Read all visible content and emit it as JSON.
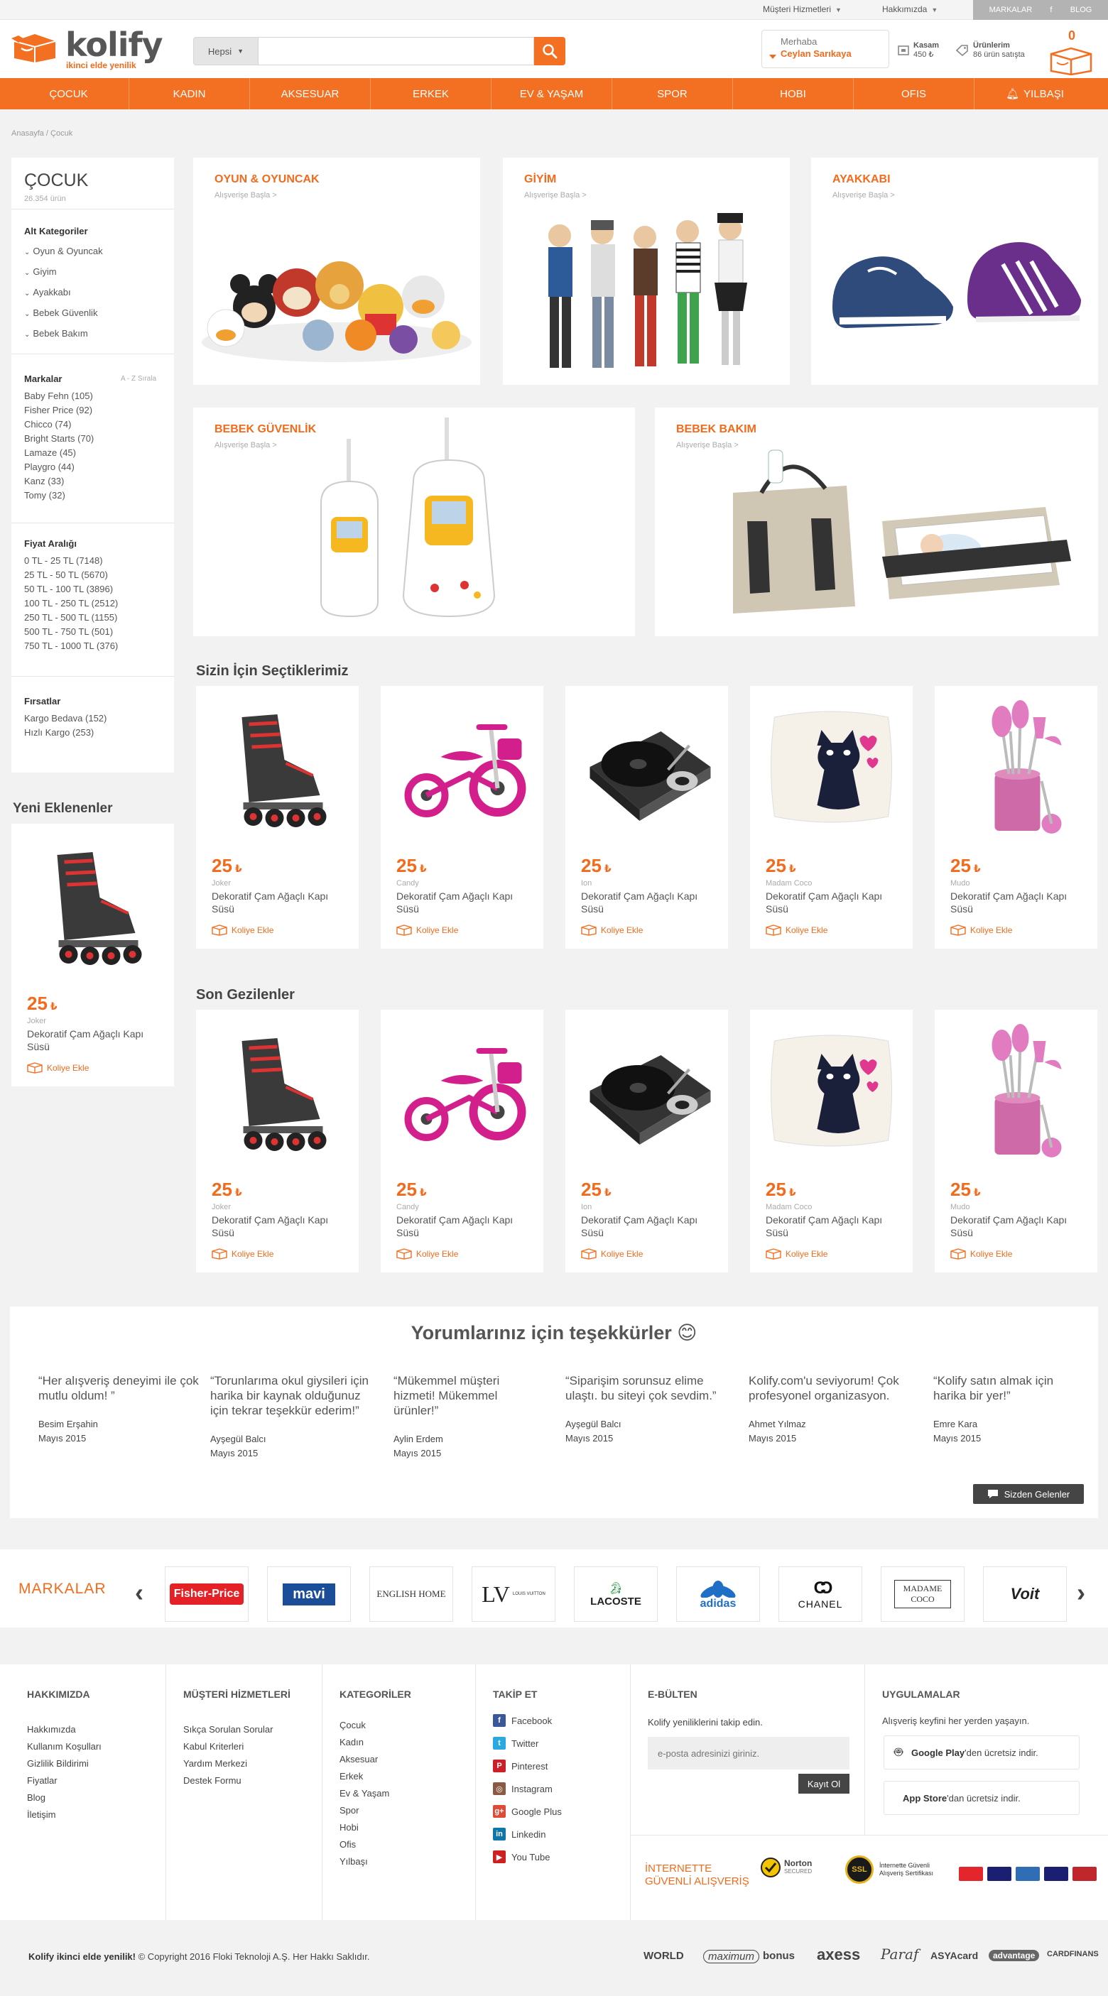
{
  "topbar": {
    "customer_service": "Müşteri Hizmetleri",
    "about": "Hakkımızda",
    "brands": "MARKALAR",
    "facebook": "f",
    "blog": "BLOG"
  },
  "header": {
    "logo_text": "kolify",
    "logo_tagline": "ikinci elde yenilik",
    "search": {
      "category": "Hepsi",
      "placeholder": ""
    },
    "user": {
      "greeting": "Merhaba",
      "name": "Ceylan Sarıkaya"
    },
    "wallet": {
      "label": "Kasam",
      "value": "450 ₺"
    },
    "products": {
      "label": "Ürünlerim",
      "value": "86 ürün satışta"
    },
    "cart_count": "0"
  },
  "nav": [
    "ÇOCUK",
    "KADIN",
    "AKSESUAR",
    "ERKEK",
    "EV & YAŞAM",
    "SPOR",
    "HOBI",
    "OFIS",
    "YILBAŞI"
  ],
  "breadcrumb": "Anasayfa  /  Çocuk",
  "sidebar": {
    "title": "ÇOCUK",
    "count": "26.354 ürün",
    "subcat_title": "Alt Kategoriler",
    "subcats": [
      "Oyun & Oyuncak",
      "Giyim",
      "Ayakkabı",
      "Bebek Güvenlik",
      "Bebek Bakım"
    ],
    "brands_title": "Markalar",
    "brands_sort": "A - Z Sırala",
    "brands": [
      "Baby Fehn (105)",
      "Fisher Price (92)",
      "Chicco (74)",
      "Bright Starts (70)",
      "Lamaze (45)",
      "Playgro (44)",
      "Kanz (33)",
      "Tomy (32)"
    ],
    "price_title": "Fiyat Aralığı",
    "prices": [
      "0 TL - 25 TL (7148)",
      "25 TL - 50 TL (5670)",
      "50 TL - 100 TL (3896)",
      "100 TL - 250 TL (2512)",
      "250 TL - 500 TL (1155)",
      "500 TL - 750 TL (501)",
      "750 TL - 1000 TL (376)"
    ],
    "deals_title": "Fırsatlar",
    "deals": [
      "Kargo Bedava (152)",
      "Hızlı Kargo (253)"
    ]
  },
  "new_added": {
    "title": "Yeni Eklenenler",
    "price": "25",
    "currency": "₺",
    "brand": "Joker",
    "name": "Dekoratif Çam Ağaçlı Kapı Süsü",
    "add": "Koliye Ekle"
  },
  "tiles": [
    {
      "title": "OYUN & OYUNCAK",
      "sub": "Alışverişe Başla >"
    },
    {
      "title": "GİYİM",
      "sub": "Alışverişe Başla >"
    },
    {
      "title": "AYAKKABI",
      "sub": "Alışverişe Başla >"
    },
    {
      "title": "BEBEK GÜVENLİK",
      "sub": "Alışverişe Başla >"
    },
    {
      "title": "BEBEK BAKIM",
      "sub": "Alışverişe Başla >"
    }
  ],
  "picks_title": "Sizin İçin Seçtiklerimiz",
  "recent_title": "Son Gezilenler",
  "products": [
    {
      "img": "skate-icon",
      "price": "25",
      "currency": "₺",
      "brand": "Joker",
      "name": "Dekoratif Çam Ağaçlı Kapı Süsü",
      "add": "Koliye Ekle"
    },
    {
      "img": "tricycle-icon",
      "price": "25",
      "currency": "₺",
      "brand": "Candy",
      "name": "Dekoratif Çam Ağaçlı Kapı Süsü",
      "add": "Koliye Ekle"
    },
    {
      "img": "turntable-icon",
      "price": "25",
      "currency": "₺",
      "brand": "Ion",
      "name": "Dekoratif Çam Ağaçlı Kapı Süsü",
      "add": "Koliye Ekle"
    },
    {
      "img": "cat-pillow-icon",
      "price": "25",
      "currency": "₺",
      "brand": "Madam Coco",
      "name": "Dekoratif Çam Ağaçlı Kapı Süsü",
      "add": "Koliye Ekle"
    },
    {
      "img": "utensils-icon",
      "price": "25",
      "currency": "₺",
      "brand": "Mudo",
      "name": "Dekoratif Çam Ağaçlı Kapı Süsü",
      "add": "Koliye Ekle"
    }
  ],
  "reviews": {
    "title": "Yorumlarınız için teşekkürler 😊",
    "items": [
      {
        "quote": "“Her alışveriş deneyimi ile çok mutlu oldum! ”",
        "author": "Besim Erşahin",
        "date": "Mayıs 2015"
      },
      {
        "quote": "“Torunlarıma okul giysileri için harika bir kaynak olduğunuz için tekrar teşekkür ederim!”",
        "author": "Ayşegül Balcı",
        "date": "Mayıs 2015"
      },
      {
        "quote": "“Mükemmel müşteri hizmeti! Mükemmel ürünler!”",
        "author": "Aylin Erdem",
        "date": "Mayıs 2015"
      },
      {
        "quote": "“Siparişim sorunsuz elime ulaştı. bu siteyi çok sevdim.”",
        "author": "Ayşegül Balcı",
        "date": "Mayıs 2015"
      },
      {
        "quote": "Kolify.com'u seviyorum! Çok profesyonel organizasyon.",
        "author": "Ahmet Yılmaz",
        "date": "Mayıs 2015"
      },
      {
        "quote": "“Kolify satın almak için harika bir yer!”",
        "author": "Emre Kara",
        "date": "Mayıs 2015"
      }
    ],
    "button": "Sizden Gelenler"
  },
  "brands_strip": {
    "title": "MARKALAR",
    "logos": [
      "Fisher-Price",
      "mavi",
      "ENGLISH HOME",
      "LOUIS VUITTON",
      "LACOSTE",
      "adidas",
      "CHANEL",
      "MADAME COCO",
      "Voit"
    ]
  },
  "footer": {
    "about": {
      "title": "HAKKIMIZDA",
      "links": [
        "Hakkımızda",
        "Kullanım Koşulları",
        "Gizlilik Bildirimi",
        "Fiyatlar",
        "Blog",
        "İletişim"
      ]
    },
    "service": {
      "title": "MÜŞTERİ HİZMETLERİ",
      "links": [
        "Sıkça Sorulan Sorular",
        "Kabul Kriterleri",
        "Yardım Merkezi",
        "Destek Formu"
      ]
    },
    "categories": {
      "title": "KATEGORİLER",
      "links": [
        "Çocuk",
        "Kadın",
        "Aksesuar",
        "Erkek",
        "Ev & Yaşam",
        "Spor",
        "Hobi",
        "Ofis",
        "Yılbaşı"
      ]
    },
    "follow": {
      "title": "TAKİP ET",
      "links": [
        "Facebook",
        "Twitter",
        "Pinterest",
        "Instagram",
        "Google Plus",
        "Linkedin",
        "You Tube"
      ]
    },
    "newsletter": {
      "title": "E-BÜLTEN",
      "text": "Kolify yeniliklerini takip edin.",
      "placeholder": "e-posta adresinizi giriniz.",
      "button": "Kayıt Ol"
    },
    "apps": {
      "title": "UYGULAMALAR",
      "text": "Alışveriş keyfini her yerden yaşayın.",
      "google_b": "Google Play",
      "google_r": "'den ücretsiz indir.",
      "apple_b": "App Store",
      "apple_r": "'dan ücretsiz indir."
    },
    "secure": {
      "line1": "İNTERNETTE",
      "line2": "GÜVENLİ ALIŞVERİŞ",
      "norton": "Norton",
      "norton_sub": "SECURED",
      "ssl": "SSL",
      "ssl_text": "İnternette Güvenli Alışveriş Sertifikası"
    },
    "copyright_b": "Kolify ikinci elde yenilik!",
    "copyright": " © Copyright 2016 Floki Teknoloji A.Ş. Her Hakkı Saklıdır.",
    "cards": [
      "WORLD",
      "maximum",
      "bonus",
      "axess",
      "Paraf",
      "ASYAcard",
      "advantage",
      "CARDFINANS"
    ]
  },
  "colors": {
    "accent": "#f36f21",
    "dark": "#454545"
  }
}
